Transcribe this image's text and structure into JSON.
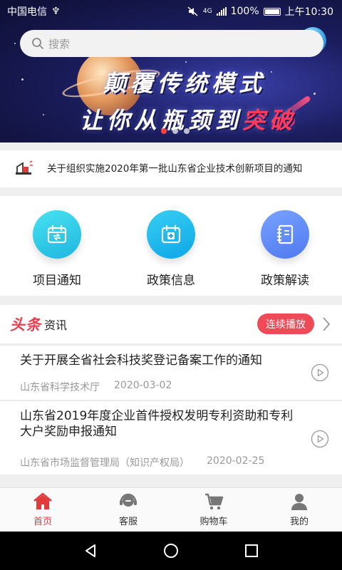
{
  "status_bar": {
    "carrier": "中国电信",
    "usb_symbol": "♆",
    "network_type": "4G",
    "battery": "100%",
    "time": "上午10:30"
  },
  "search": {
    "placeholder": "搜索"
  },
  "banner": {
    "line1": "颠覆传统模式",
    "line2_main": "让你从瓶颈到",
    "line2_highlight": "突破",
    "dots_count": 3,
    "active_dot": 0
  },
  "notice": {
    "text": "关于组织实施2020年第一批山东省企业技术创新项目的通知",
    "icon": "megaphone-icon"
  },
  "quick_entries": [
    {
      "label": "项目通知",
      "icon": "calendar-share-icon"
    },
    {
      "label": "政策信息",
      "icon": "calendar-plus-icon"
    },
    {
      "label": "政策解读",
      "icon": "notebook-icon"
    }
  ],
  "headline": {
    "logo": "头条",
    "sub": "资讯",
    "play_label": "连续播放"
  },
  "news": [
    {
      "title": "关于开展全省社会科技奖登记备案工作的通知",
      "source": "山东省科学技术厅",
      "date": "2020-03-02"
    },
    {
      "title": "山东省2019年度企业首件授权发明专利资助和专利大户奖励申报通知",
      "source": "山东省市场监督管理局（知识产权局）",
      "date": "2020-02-25"
    }
  ],
  "tabs": [
    {
      "label": "首页",
      "icon": "home-icon",
      "active": true
    },
    {
      "label": "客服",
      "icon": "customer-service-icon",
      "active": false
    },
    {
      "label": "购物车",
      "icon": "cart-icon",
      "active": false
    },
    {
      "label": "我的",
      "icon": "user-icon",
      "active": false
    }
  ],
  "colors": {
    "accent": "#e23b3b",
    "play_button": "#ef4a57",
    "banner_bg": "#1b1d5e"
  }
}
